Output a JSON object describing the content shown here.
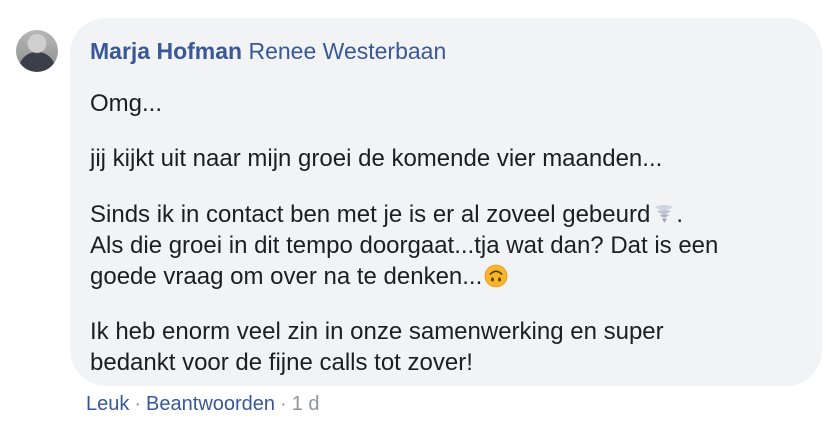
{
  "comment": {
    "author": "Marja Hofman",
    "mention": "Renee Westerbaan",
    "paragraphs": {
      "p1": "Omg...",
      "p2": "jij kijkt uit naar mijn groei de komende vier maanden...",
      "p3_line1": "Sinds ik in contact ben met je is er al zoveel gebeurd",
      "p3_line1_end": ".",
      "p3_line2": "Als die groei in dit tempo doorgaat...tja wat dan? Dat is een",
      "p3_line3": "goede vraag om over na te denken...",
      "p4_line1": "Ik heb enorm veel zin in onze samenwerking en super",
      "p4_line2": "bedankt voor de fijne calls tot zover!"
    },
    "emojis": {
      "p3_line1": "tornado-emoji",
      "p3_line3": "upside-down-face-emoji"
    }
  },
  "actions": {
    "like": "Leuk",
    "separator": "·",
    "reply": "Beantwoorden",
    "time": "1 d"
  },
  "colors": {
    "link": "#385898",
    "bubble": "#f2f3f5",
    "muted": "#90949c",
    "text": "#1c1e21"
  }
}
